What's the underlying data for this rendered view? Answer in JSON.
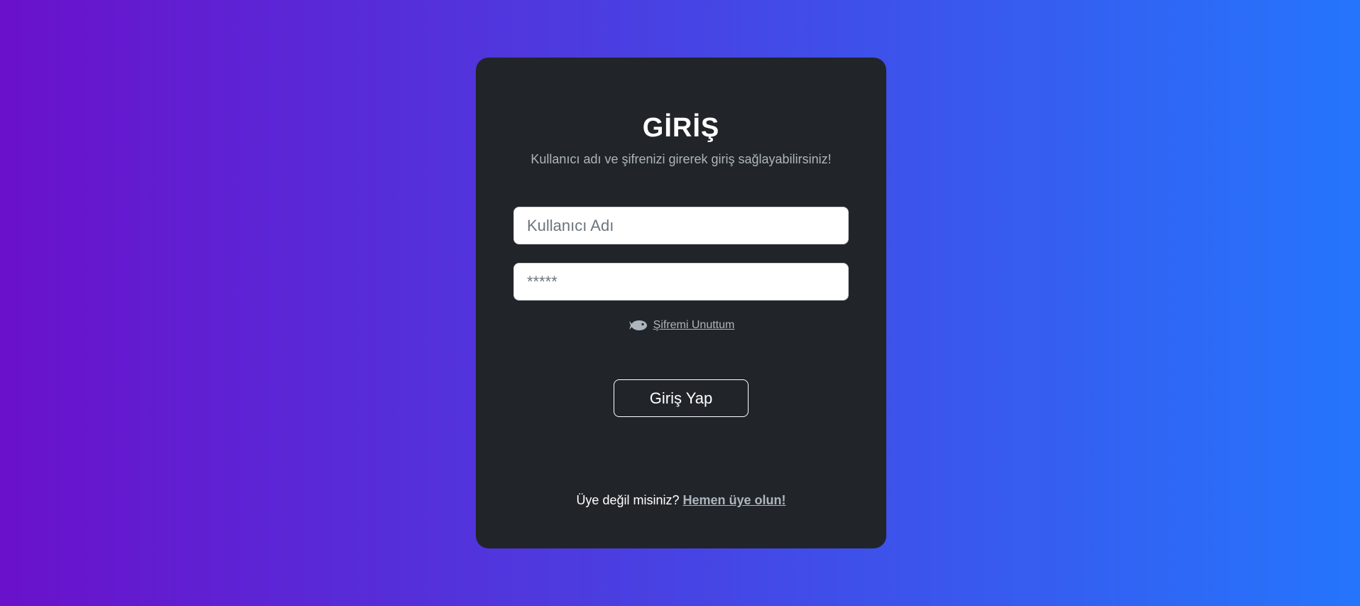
{
  "login": {
    "title": "GİRİŞ",
    "subtitle": "Kullanıcı adı ve şifrenizi girerek giriş sağlayabilirsiniz!",
    "username_placeholder": "Kullanıcı Adı",
    "password_placeholder": "*****",
    "forgot_label": "Şifremi Unuttum",
    "forgot_icon": "fish-icon",
    "submit_label": "Giriş Yap",
    "signup_prompt": "Üye değil misiniz?",
    "signup_link": "Hemen üye olun!"
  },
  "colors": {
    "gradient_start": "#6a11cb",
    "gradient_end": "#2575fc",
    "card_bg": "#212529",
    "muted_text": "#adb5bd"
  }
}
